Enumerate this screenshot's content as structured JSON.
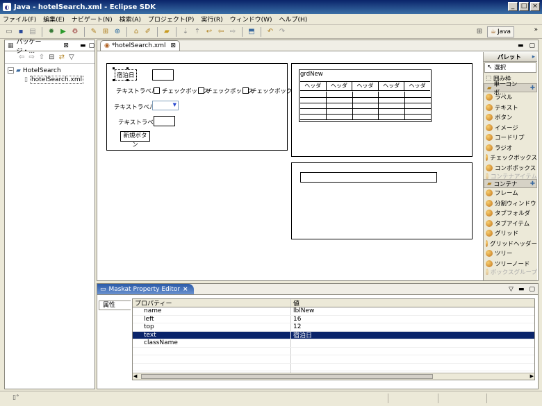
{
  "window": {
    "title": "Java - hotelSearch.xml - Eclipse SDK",
    "min": "_",
    "max": "□",
    "close": "×"
  },
  "menu": [
    "ファイル(F)",
    "編集(E)",
    "ナビゲート(N)",
    "検索(A)",
    "プロジェクト(P)",
    "実行(R)",
    "ウィンドウ(W)",
    "ヘルプ(H)"
  ],
  "perspective": {
    "label": "Java"
  },
  "package_explorer": {
    "tab": "パッケージ・...",
    "tree": [
      {
        "label": "HotelSearch",
        "kind": "project"
      },
      {
        "label": "hotelSearch.xml",
        "kind": "file"
      }
    ]
  },
  "editor": {
    "tab": "*hotelSearch.xml"
  },
  "form": {
    "lblNew": "宿泊日",
    "text_label": "テキストラベル",
    "checkbox": "チェックボックス",
    "button": "新規ボタン",
    "grid_name": "grdNew",
    "grid_headers": [
      "ヘッダ",
      "ヘッダ",
      "ヘッダ",
      "ヘッダ",
      "ヘッダ"
    ]
  },
  "palette": {
    "title": "パレット",
    "tools": [
      "選択",
      "囲み枠"
    ],
    "groups": [
      {
        "name": "単一コンポ...",
        "items": [
          "ラベル",
          "テキスト",
          "ボタン",
          "イメージ",
          "コードリプ",
          "ラジオ",
          "チェックボックス",
          "コンボボックス",
          "コンテナアイテム"
        ]
      },
      {
        "name": "コンテナ",
        "items": [
          "フレーム",
          "分割ウィンドウ",
          "タブフォルダ",
          "タブアイテム",
          "グリッド",
          "グリッドヘッダー",
          "ツリー",
          "ツリーノード",
          "ボックスグループ"
        ]
      }
    ]
  },
  "property_editor": {
    "tab": "Maskat Property Editor",
    "side_tab": "属性",
    "headers": [
      "プロパティー",
      "値"
    ],
    "rows": [
      [
        "name",
        "lblNew"
      ],
      [
        "left",
        "16"
      ],
      [
        "top",
        "12"
      ],
      [
        "text",
        "宿泊日"
      ],
      [
        "className",
        ""
      ]
    ],
    "selected_row": 3
  }
}
